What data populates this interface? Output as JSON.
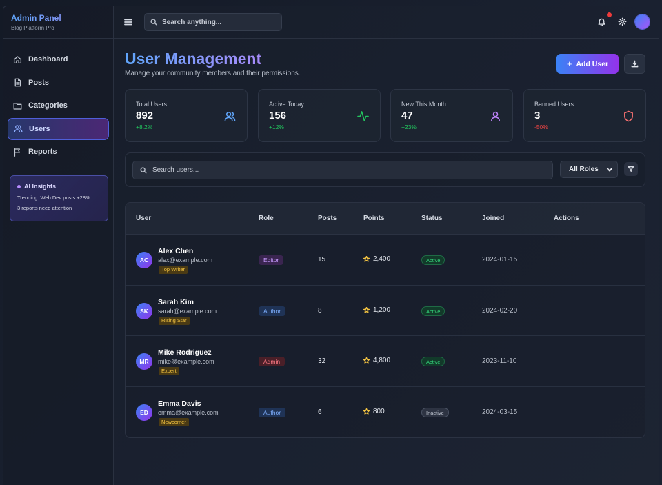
{
  "brand": {
    "title": "Admin Panel",
    "subtitle": "Blog Platform Pro"
  },
  "sidebar": {
    "items": [
      {
        "label": "Dashboard",
        "icon": "home-icon"
      },
      {
        "label": "Posts",
        "icon": "document-icon"
      },
      {
        "label": "Categories",
        "icon": "folder-icon"
      },
      {
        "label": "Users",
        "icon": "users-icon",
        "active": true
      },
      {
        "label": "Reports",
        "icon": "flag-icon"
      }
    ],
    "insights": {
      "title": "AI Insights",
      "line1": "Trending: Web Dev posts +28%",
      "line2": "3 reports need attention"
    }
  },
  "topbar": {
    "search_placeholder": "Search anything...",
    "notification_dot": true
  },
  "page": {
    "title": "User Management",
    "subtitle": "Manage your community members and their permissions.",
    "add_user_label": "Add User"
  },
  "stats": [
    {
      "label": "Total Users",
      "value": "892",
      "change": "+8.2%",
      "change_color": "#22c55e",
      "icon": "users-icon",
      "icon_color": "#60a5fa"
    },
    {
      "label": "Active Today",
      "value": "156",
      "change": "+12%",
      "change_color": "#22c55e",
      "icon": "activity-icon",
      "icon_color": "#22c55e"
    },
    {
      "label": "New This Month",
      "value": "47",
      "change": "+23%",
      "change_color": "#22c55e",
      "icon": "user-icon",
      "icon_color": "#c084fc"
    },
    {
      "label": "Banned Users",
      "value": "3",
      "change": "-50%",
      "change_color": "#ef4444",
      "icon": "shield-icon",
      "icon_color": "#f87171"
    }
  ],
  "filters": {
    "search_placeholder": "Search users...",
    "role_selected": "All Roles"
  },
  "table": {
    "columns": [
      "User",
      "Role",
      "Posts",
      "Points",
      "Status",
      "Joined",
      "Actions"
    ],
    "rows": [
      {
        "initials": "AC",
        "name": "Alex Chen",
        "email": "alex@example.com",
        "badge": "Top Writer",
        "role": "Editor",
        "posts": "15",
        "points": "2,400",
        "status": "Active",
        "joined": "2024-01-15"
      },
      {
        "initials": "SK",
        "name": "Sarah Kim",
        "email": "sarah@example.com",
        "badge": "Rising Star",
        "role": "Author",
        "posts": "8",
        "points": "1,200",
        "status": "Active",
        "joined": "2024-02-20"
      },
      {
        "initials": "MR",
        "name": "Mike Rodriguez",
        "email": "mike@example.com",
        "badge": "Expert",
        "role": "Admin",
        "posts": "32",
        "points": "4,800",
        "status": "Active",
        "joined": "2023-11-10"
      },
      {
        "initials": "ED",
        "name": "Emma Davis",
        "email": "emma@example.com",
        "badge": "Newcomer",
        "role": "Author",
        "posts": "6",
        "points": "800",
        "status": "Inactive",
        "joined": "2024-03-15"
      }
    ]
  }
}
